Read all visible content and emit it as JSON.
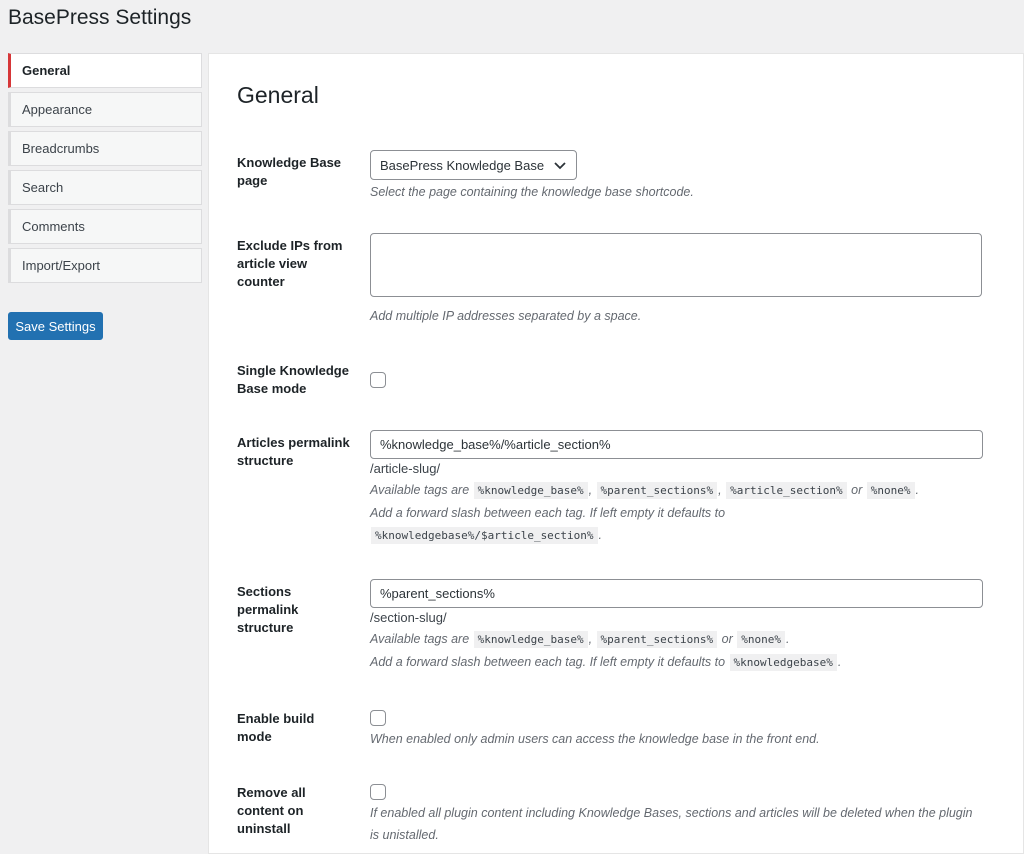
{
  "app": {
    "title": "BasePress Settings"
  },
  "sidebar": {
    "tabs": [
      {
        "label": "General",
        "active": true
      },
      {
        "label": "Appearance",
        "active": false
      },
      {
        "label": "Breadcrumbs",
        "active": false
      },
      {
        "label": "Search",
        "active": false
      },
      {
        "label": "Comments",
        "active": false
      },
      {
        "label": "Import/Export",
        "active": false
      }
    ],
    "save_label": "Save Settings"
  },
  "colors": {
    "accent": "#2271b1",
    "active_tab_border": "#d63638"
  },
  "general": {
    "title": "General",
    "kb_page": {
      "label": "Knowledge Base page",
      "selected": "BasePress Knowledge Base",
      "desc": "Select the page containing the knowledge base shortcode."
    },
    "exclude_ips": {
      "label": "Exclude IPs from article view counter",
      "value": "",
      "desc": "Add multiple IP addresses separated by a space."
    },
    "single_kb": {
      "label": "Single Knowledge Base mode",
      "checked": false
    },
    "articles_permalink": {
      "label": "Articles permalink structure",
      "value": "%knowledge_base%/%article_section%",
      "slug": "/article-slug/",
      "available_prefix": "Available tags are",
      "tag1": "%knowledge_base%",
      "tag2": "%parent_sections%",
      "tag3": "%article_section%",
      "or_word": "or",
      "tag4": "%none%",
      "default_text": "Add a forward slash between each tag. If left empty it defaults to",
      "default_tag": "%knowledgebase%/$article_section%"
    },
    "sections_permalink": {
      "label": "Sections permalink structure",
      "value": "%parent_sections%",
      "slug": "/section-slug/",
      "available_prefix": "Available tags are",
      "tag1": "%knowledge_base%",
      "tag2": "%parent_sections%",
      "or_word": "or",
      "tag3": "%none%",
      "default_text": "Add a forward slash between each tag. If left empty it defaults to",
      "default_tag": "%knowledgebase%"
    },
    "build_mode": {
      "label": "Enable build mode",
      "checked": false,
      "desc": "When enabled only admin users can access the knowledge base in the front end."
    },
    "remove_content": {
      "label": "Remove all content on uninstall",
      "checked": false,
      "desc": "If enabled all plugin content including Knowledge Bases, sections and articles will be deleted when the plugin is unistalled."
    }
  }
}
